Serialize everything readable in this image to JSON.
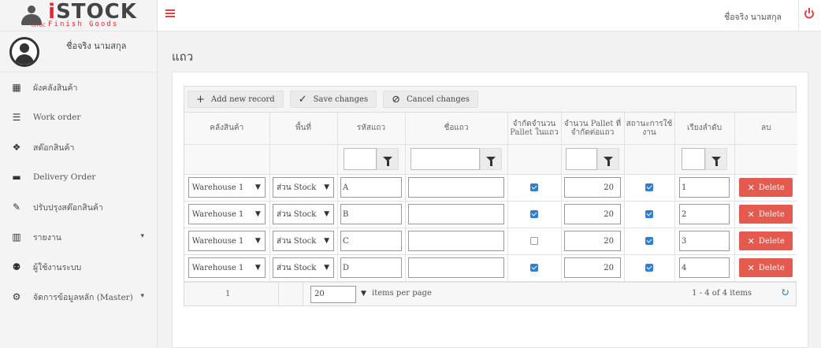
{
  "logo": {
    "title_i": "i",
    "title_rest": "STOCK",
    "subtitle": "Finish Goods",
    "small": "iSTOC"
  },
  "user": {
    "name": "ชื่อจริง นามสกุล"
  },
  "sidebar": {
    "items": [
      {
        "label": "ผังคลังสินค้า",
        "icon": "grid-icon"
      },
      {
        "label": "Work order",
        "icon": "list-icon"
      },
      {
        "label": "สต๊อกสินค้า",
        "icon": "cubes-icon"
      },
      {
        "label": "Delivery Order",
        "icon": "truck-icon"
      },
      {
        "label": "ปรับปรุงสต๊อกสินค้า",
        "icon": "edit-icon"
      },
      {
        "label": "รายงาน",
        "icon": "bar-chart-icon",
        "chevron": "▾"
      },
      {
        "label": "ผู้ใช้งานระบบ",
        "icon": "users-icon"
      },
      {
        "label": "จัดการข้อมูลหลัก (Master)",
        "icon": "gears-icon",
        "chevron": "▾"
      }
    ]
  },
  "topbar": {
    "user_name": "ชื่อจริง นามสกุล"
  },
  "page": {
    "title": "แถว"
  },
  "toolbar": {
    "add_label": "Add new record",
    "save_label": "Save changes",
    "cancel_label": "Cancel changes"
  },
  "columns": [
    "คลังสินค้า",
    "พื้นที่",
    "รหัสแถว",
    "ชื่อแถว",
    "จำกัดจำนวน Pallet ในแถว",
    "จำนวน Pallet ที่จำกัดต่อแถว",
    "สถานะการใช้งาน",
    "เรียงลำดับ",
    "ลบ"
  ],
  "rows": [
    {
      "warehouse": "Warehouse 1",
      "area": "ส่วน Stock",
      "code": "A",
      "name": "",
      "limit": true,
      "pallets": "20",
      "active": true,
      "order": "1",
      "delete": "Delete"
    },
    {
      "warehouse": "Warehouse 1",
      "area": "ส่วน Stock",
      "code": "B",
      "name": "",
      "limit": true,
      "pallets": "20",
      "active": true,
      "order": "2",
      "delete": "Delete"
    },
    {
      "warehouse": "Warehouse 1",
      "area": "ส่วน Stock",
      "code": "C",
      "name": "",
      "limit": false,
      "pallets": "20",
      "active": true,
      "order": "3",
      "delete": "Delete"
    },
    {
      "warehouse": "Warehouse 1",
      "area": "ส่วน Stock",
      "code": "D",
      "name": "",
      "limit": true,
      "pallets": "20",
      "active": true,
      "order": "4",
      "delete": "Delete"
    }
  ],
  "pager": {
    "page": "1",
    "page_size": "20",
    "items_label": "items per page",
    "info": "1 - 4 of 4 items"
  },
  "colors": {
    "accent_red": "#e55a4e",
    "checkbox_blue": "#2e7fd4",
    "hamburger_red": "#e04040"
  }
}
